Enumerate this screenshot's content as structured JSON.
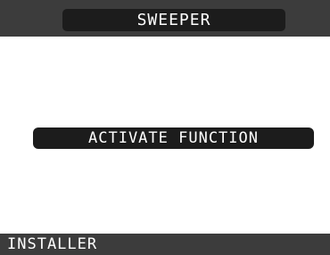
{
  "header": {
    "title": "SWEEPER"
  },
  "main": {
    "function_label": "ACTIVATE FUNCTION"
  },
  "footer": {
    "mode_label": "INSTALLER"
  },
  "colors": {
    "background": "#ffffff",
    "bar": "#3c3c3c",
    "pill": "#1c1c1c",
    "text_on_dark": "#ffffff"
  }
}
